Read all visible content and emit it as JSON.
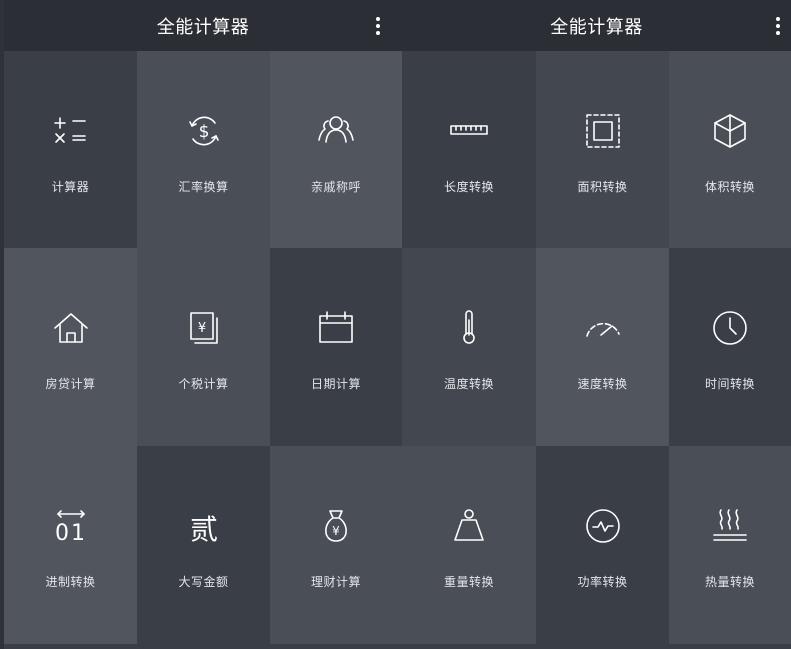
{
  "screens": [
    {
      "title": "全能计算器",
      "tiles": [
        {
          "label": "计算器",
          "icon": "calculator-icon"
        },
        {
          "label": "汇率换算",
          "icon": "currency-exchange-icon"
        },
        {
          "label": "亲戚称呼",
          "icon": "relatives-icon"
        },
        {
          "label": "房贷计算",
          "icon": "house-icon"
        },
        {
          "label": "个税计算",
          "icon": "tax-document-icon"
        },
        {
          "label": "日期计算",
          "icon": "calendar-icon"
        },
        {
          "label": "进制转换",
          "icon": "binary-icon"
        },
        {
          "label": "大写金额",
          "icon": "chinese-numeral-icon"
        },
        {
          "label": "理财计算",
          "icon": "money-bag-icon"
        }
      ]
    },
    {
      "title": "全能计算器",
      "tiles": [
        {
          "label": "长度转换",
          "icon": "ruler-icon"
        },
        {
          "label": "面积转换",
          "icon": "area-icon"
        },
        {
          "label": "体积转换",
          "icon": "cube-icon"
        },
        {
          "label": "温度转换",
          "icon": "thermometer-icon"
        },
        {
          "label": "速度转换",
          "icon": "speedometer-icon"
        },
        {
          "label": "时间转换",
          "icon": "clock-icon"
        },
        {
          "label": "重量转换",
          "icon": "weight-icon"
        },
        {
          "label": "功率转换",
          "icon": "power-icon"
        },
        {
          "label": "热量转换",
          "icon": "heat-icon"
        }
      ]
    }
  ],
  "glyphs": {
    "yen": "¥",
    "binary": "01",
    "daxie": "贰"
  }
}
